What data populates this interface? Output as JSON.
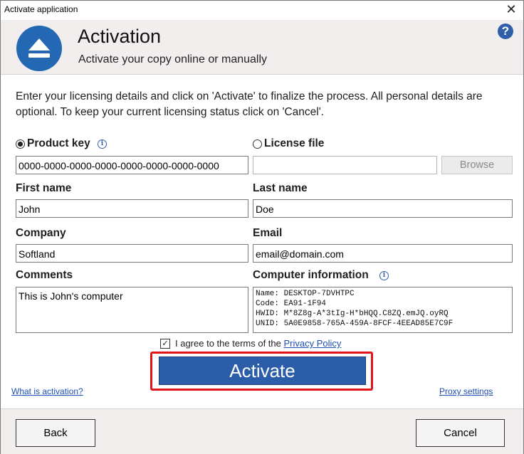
{
  "window": {
    "title": "Activate application",
    "close_glyph": "✕"
  },
  "header": {
    "title": "Activation",
    "subtitle": "Activate your copy online or manually",
    "logo_icon": "eject-icon",
    "help_glyph": "?",
    "accent_color": "#2468b4"
  },
  "intro": "Enter your licensing details and click on 'Activate' to finalize the process. All personal details are optional. To keep your current licensing status click on 'Cancel'.",
  "product_key": {
    "label": "Product key",
    "selected": true,
    "value": "0000-0000-0000-0000-0000-0000-0000-0000",
    "info_glyph": "i"
  },
  "license_file": {
    "label": "License file",
    "selected": false,
    "value": "",
    "browse_label": "Browse"
  },
  "first_name": {
    "label": "First name",
    "value": "John"
  },
  "last_name": {
    "label": "Last name",
    "value": "Doe"
  },
  "company": {
    "label": "Company",
    "value": "Softland"
  },
  "email": {
    "label": "Email",
    "value": "email@domain.com"
  },
  "comments": {
    "label": "Comments",
    "value": "This is John's computer"
  },
  "computer_info": {
    "label": "Computer information",
    "info_glyph": "i",
    "value": "Name: DESKTOP-7DVHTPC\nCode: EA91-1F94\nHWID: M*8Z8g-A*3tIg-H*bHQQ.C8ZQ.emJQ.oyRQ\nUNID: 5A0E9858-765A-459A-8FCF-4EEAD85E7C9F"
  },
  "agree": {
    "checked": true,
    "check_glyph": "✓",
    "text": "I agree to the terms of the",
    "link": "Privacy Policy"
  },
  "activate_label": "Activate",
  "what_is_activation": "What is activation?",
  "proxy_settings": "Proxy settings",
  "back_label": "Back",
  "cancel_label": "Cancel",
  "colors": {
    "highlight": "#e0141a",
    "activate_button": "#2b5da8",
    "link": "#1d4fb3"
  }
}
